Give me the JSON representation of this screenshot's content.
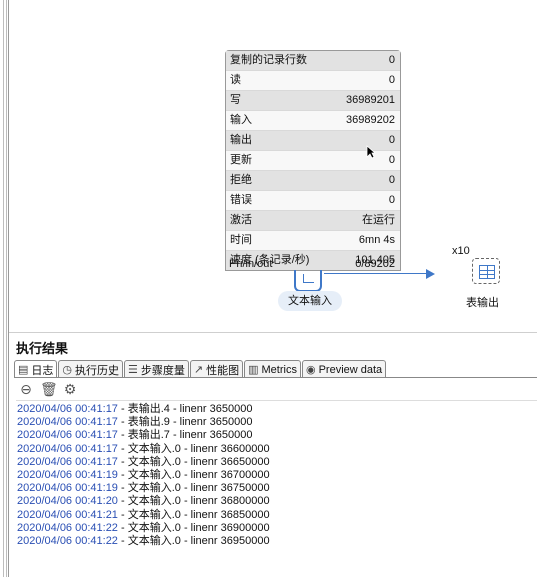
{
  "metrics": {
    "rows": [
      {
        "label": "复制的记录行数",
        "value": "0"
      },
      {
        "label": "读",
        "value": "0"
      },
      {
        "label": "写",
        "value": "36989201"
      },
      {
        "label": "输入",
        "value": "36989202"
      },
      {
        "label": "输出",
        "value": "0"
      },
      {
        "label": "更新",
        "value": "0"
      },
      {
        "label": "拒绝",
        "value": "0"
      },
      {
        "label": "错误",
        "value": "0"
      },
      {
        "label": "激活",
        "value": "在运行"
      },
      {
        "label": "时间",
        "value": "6mn 4s"
      },
      {
        "label": "速度 (条记录/秒)",
        "value": "101,405"
      }
    ],
    "pio_label": "Pri/in/out",
    "pio_value": "0/89202"
  },
  "steps": {
    "text_input": "文本输入",
    "table_output": "表输出",
    "copies": "x10"
  },
  "results": {
    "title": "执行结果",
    "tabs": [
      {
        "label": "日志",
        "icon": "document-icon"
      },
      {
        "label": "执行历史",
        "icon": "history-icon"
      },
      {
        "label": "步骤度量",
        "icon": "step-metrics-icon"
      },
      {
        "label": "性能图",
        "icon": "chart-icon"
      },
      {
        "label": "Metrics",
        "icon": "metrics-icon"
      },
      {
        "label": "Preview data",
        "icon": "eye-icon"
      }
    ],
    "log": [
      {
        "ts": "2020/04/06 00:41:17",
        "msg": " - 表输出.4 - linenr 3650000"
      },
      {
        "ts": "2020/04/06 00:41:17",
        "msg": " - 表输出.9 - linenr 3650000"
      },
      {
        "ts": "2020/04/06 00:41:17",
        "msg": " - 表输出.7 - linenr 3650000"
      },
      {
        "ts": "2020/04/06 00:41:17",
        "msg": " - 文本输入.0 - linenr 36600000"
      },
      {
        "ts": "2020/04/06 00:41:17",
        "msg": " - 文本输入.0 - linenr 36650000"
      },
      {
        "ts": "2020/04/06 00:41:19",
        "msg": " - 文本输入.0 - linenr 36700000"
      },
      {
        "ts": "2020/04/06 00:41:19",
        "msg": " - 文本输入.0 - linenr 36750000"
      },
      {
        "ts": "2020/04/06 00:41:20",
        "msg": " - 文本输入.0 - linenr 36800000"
      },
      {
        "ts": "2020/04/06 00:41:21",
        "msg": " - 文本输入.0 - linenr 36850000"
      },
      {
        "ts": "2020/04/06 00:41:22",
        "msg": " - 文本输入.0 - linenr 36900000"
      },
      {
        "ts": "2020/04/06 00:41:22",
        "msg": " - 文本输入.0 - linenr 36950000"
      }
    ]
  }
}
